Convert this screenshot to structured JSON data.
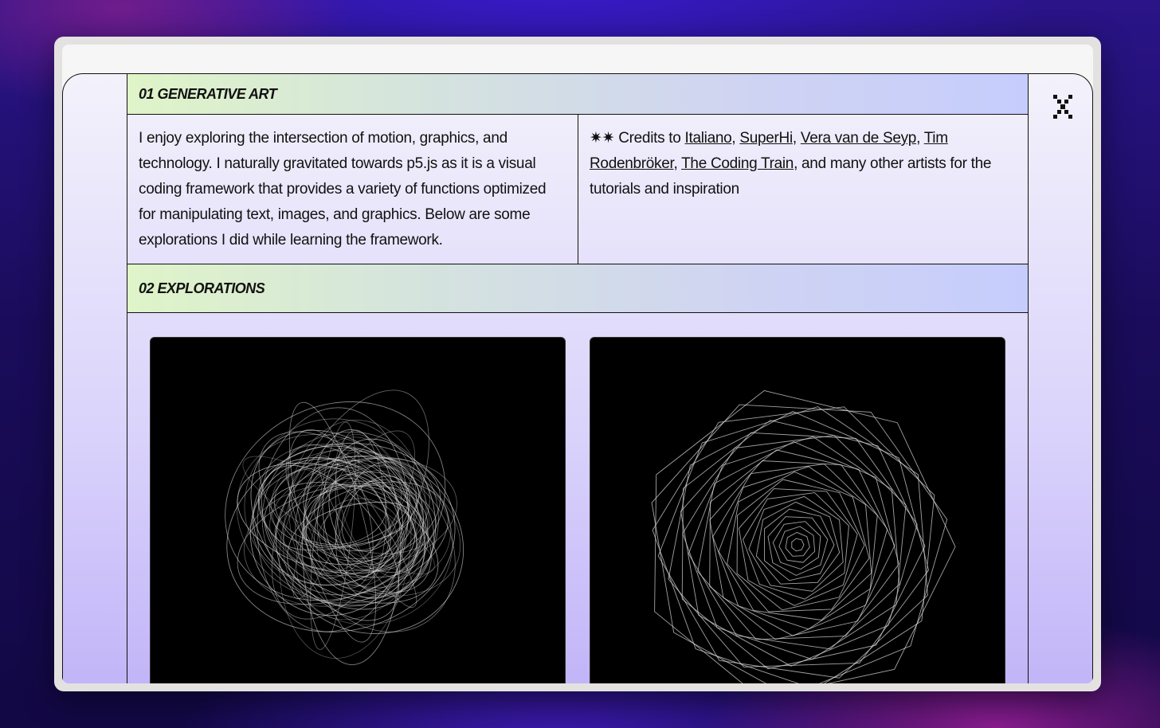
{
  "sections": {
    "generative_art": {
      "title": "01 GENERATIVE ART"
    },
    "explorations": {
      "title": "02 EXPLORATIONS"
    }
  },
  "intro": {
    "description": "I enjoy exploring the intersection of motion, graphics, and technology. I naturally gravitated towards p5.js as it is a visual coding framework that provides a variety of functions optimized for manipulating text, images, and graphics. Below are some explorations I did while learning the framework.",
    "credits_prefix": "✷✷ Credits to ",
    "credit_links": [
      "Italiano",
      "SuperHi",
      "Vera van de Seyp",
      "Tim Rodenbröker",
      "The Coding Train"
    ],
    "credits_suffix": ", and many other artists for the tutorials and inspiration"
  },
  "icons": {
    "close": "close-icon"
  },
  "colors": {
    "header_gradient_start": "#dff4c8",
    "header_gradient_end": "#c6cdfc",
    "page_bg_bottom": "#c2b5f8",
    "artwork_bg": "#000000",
    "artwork_stroke": "#d9d9d9"
  }
}
